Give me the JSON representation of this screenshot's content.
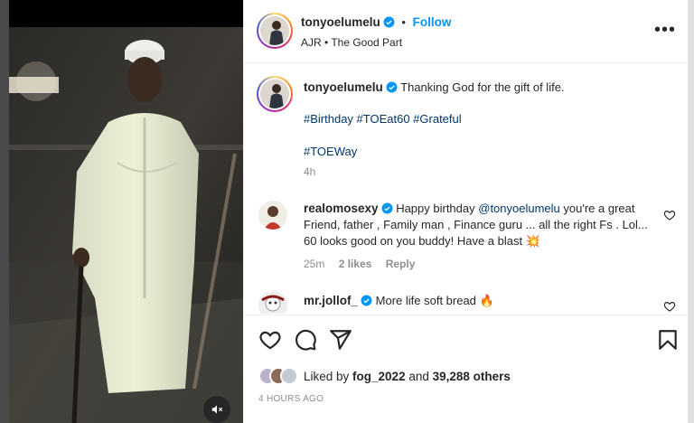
{
  "post": {
    "author": "tonyoelumelu",
    "follow_label": "Follow",
    "separator": "•",
    "audio": "AJR • The Good Part"
  },
  "caption": {
    "username": "tonyoelumelu",
    "text": "Thanking God for the gift of life.",
    "hashtags_line1": "#Birthday #TOEat60 #Grateful",
    "hashtags_line2": "#TOEWay",
    "age": "4h"
  },
  "comments": [
    {
      "username": "realomosexy",
      "text_before_mention": "Happy birthday ",
      "mention": "@tonyoelumelu",
      "text_after_mention": " you're a great Friend, father , Family man , Finance guru ... all the right Fs . Lol... 60 looks good on you buddy! Have a blast",
      "emoji": "💥",
      "age": "25m",
      "likes": "2 likes",
      "reply_label": "Reply"
    },
    {
      "username": "mr.jollof_",
      "text": "More life soft bread",
      "emoji": "🔥"
    }
  ],
  "likes": {
    "liked_by_prefix": "Liked by ",
    "liked_by_user": "fog_2022",
    "and_label": " and ",
    "others": "39,288 others"
  },
  "timestamp": "4 HOURS AGO",
  "icons": {
    "more": "more-options-icon",
    "verified": "verified-badge-icon",
    "like": "heart-icon",
    "comment": "comment-icon",
    "share": "share-icon",
    "save": "bookmark-icon",
    "mute": "mute-icon"
  },
  "colors": {
    "accent": "#0095f6",
    "text": "#262626",
    "muted": "#8e8e8e",
    "hashtag": "#00376b",
    "verified": "#0095f6"
  }
}
